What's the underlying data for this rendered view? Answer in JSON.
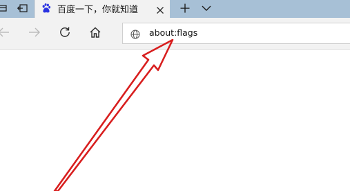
{
  "tabs": {
    "active_title": "百度一下，你就知道"
  },
  "toolbar": {
    "address_value": "about:flags"
  },
  "icons": {
    "tab_preview": "tab-preview-icon",
    "set_aside": "set-aside-tabs-icon",
    "favicon": "baidu-paw-icon",
    "close": "close-icon",
    "new_tab": "plus-icon",
    "tab_list": "chevron-down-icon",
    "back": "back-arrow-icon",
    "forward": "forward-arrow-icon",
    "refresh": "refresh-icon",
    "home": "home-icon",
    "site": "globe-icon",
    "annotation": "red-arrow-annotation"
  },
  "colors": {
    "tab_strip": "#a7c0d6",
    "toolbar": "#f2f2f2",
    "baidu_blue": "#2932e1",
    "annotation_red": "#d81e1e"
  }
}
